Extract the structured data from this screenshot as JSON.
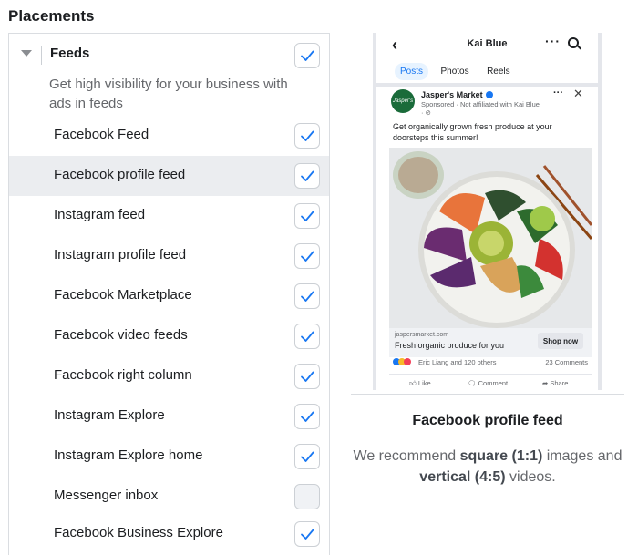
{
  "section_title": "Placements",
  "group": {
    "title": "Feeds",
    "description": "Get high visibility for your business with ads in feeds",
    "checked": true
  },
  "placements": [
    {
      "label": "Facebook Feed",
      "checked": true,
      "active": false
    },
    {
      "label": "Facebook profile feed",
      "checked": true,
      "active": true
    },
    {
      "label": "Instagram feed",
      "checked": true,
      "active": false
    },
    {
      "label": "Instagram profile feed",
      "checked": true,
      "active": false
    },
    {
      "label": "Facebook Marketplace",
      "checked": true,
      "active": false
    },
    {
      "label": "Facebook video feeds",
      "checked": true,
      "active": false
    },
    {
      "label": "Facebook right column",
      "checked": true,
      "active": false
    },
    {
      "label": "Instagram Explore",
      "checked": true,
      "active": false
    },
    {
      "label": "Instagram Explore home",
      "checked": true,
      "active": false
    },
    {
      "label": "Messenger inbox",
      "checked": false,
      "active": false
    },
    {
      "label": "Facebook Business Explore",
      "checked": true,
      "active": false
    }
  ],
  "preview": {
    "profile_name": "Kai Blue",
    "tabs": [
      "Posts",
      "Photos",
      "Reels"
    ],
    "active_tab": "Posts",
    "advertiser": "Jasper's Market",
    "logo_text": "Jasper's",
    "sponsored_text": "Sponsored · Not affiliated with Kai Blue · ⊘",
    "ad_text": "Get organically grown fresh produce at your doorsteps this summer!",
    "cta_url": "jaspersmarket.com",
    "cta_title": "Fresh organic produce for you",
    "cta_button": "Shop now",
    "reactions_text": "Eric Liang and 120 others",
    "comments_text": "23 Comments",
    "actions": [
      "Like",
      "Comment",
      "Share"
    ],
    "title": "Facebook profile feed",
    "rec_prefix": "We recommend ",
    "rec_square": "square (1:1)",
    "rec_middle": " images and ",
    "rec_vertical": "vertical (4:5)",
    "rec_suffix": " videos."
  },
  "colors": {
    "accent": "#1877f2",
    "active_row": "#ebedf0",
    "border": "#dadde1"
  },
  "icons": {
    "check": "check-icon",
    "caret": "caret-down-icon",
    "back": "back-arrow-icon",
    "search": "search-icon",
    "more": "more-icon",
    "close": "close-icon"
  }
}
